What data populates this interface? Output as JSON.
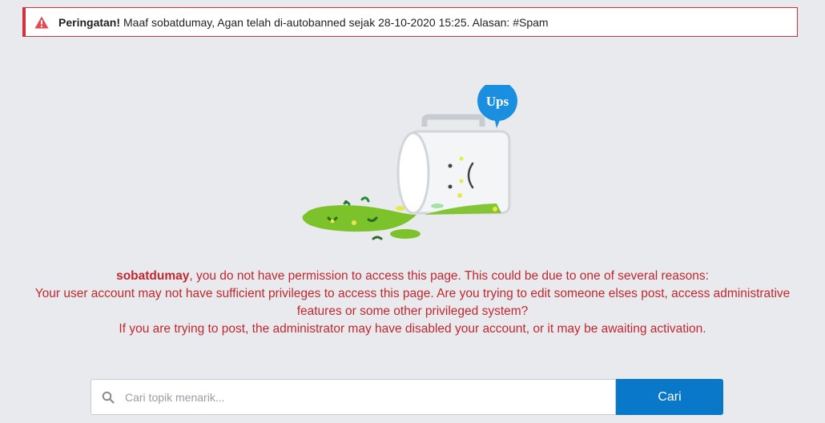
{
  "alert": {
    "title": "Peringatan!",
    "message": "Maaf sobatdumay, Agan telah di-autobanned sejak 28-10-2020 15:25. Alasan: #Spam",
    "icon": "warning-triangle-icon",
    "color": "#d2323c"
  },
  "illustration": {
    "bubble_text": "Ups",
    "face": ": ("
  },
  "message": {
    "username": "sobatdumay",
    "line1_rest": ", you do not have permission to access this page. This could be due to one of several reasons:",
    "line2": "Your user account may not have sufficient privileges to access this page. Are you trying to edit someone elses post, access administrative features or some other privileged system?",
    "line3": "If you are trying to post, the administrator may have disabled your account, or it may be awaiting activation.",
    "color": "#c0282f"
  },
  "search": {
    "placeholder": "Cari topik menarik...",
    "value": "",
    "icon": "search-icon",
    "button_label": "Cari",
    "button_color": "#0a78c8"
  }
}
